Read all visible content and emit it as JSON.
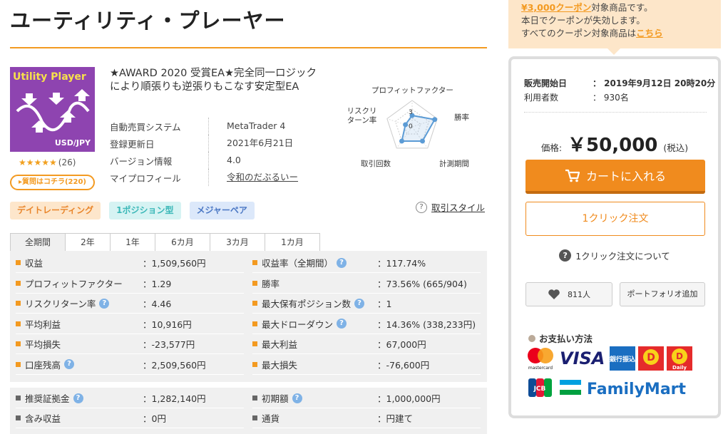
{
  "page": {
    "title": "ユーティリティ・プレーヤー"
  },
  "product": {
    "image_title": "Utility Player",
    "image_pair": "USD/JPY",
    "rating_stars": "★★★★★",
    "rating_count": "(26)",
    "qa_button": "▸質問はコチラ(220)",
    "headline": "★AWARD 2020 受賞EA★完全同一ロジックにより順張りも逆張りもこなす安定型EA",
    "meta": [
      {
        "label": "自動売買システム",
        "value": "MetaTrader 4"
      },
      {
        "label": "登録更新日",
        "value": "2021年6月21日"
      },
      {
        "label": "バージョン情報",
        "value": "4.0"
      },
      {
        "label": "マイプロフィール",
        "value": "令和のだぶるいー"
      }
    ],
    "tags": [
      "デイトレーディング",
      "1ポジション型",
      "メジャーペア"
    ],
    "trade_style_link": "取引スタイル"
  },
  "radar": {
    "labels": {
      "profit_factor": "プロフィットファクター",
      "win_rate": "勝率",
      "period": "計測期間",
      "trades": "取引回数",
      "risk_return": "リスクリターン率"
    },
    "scale_max": "3",
    "scale_min": "0",
    "values": {
      "profit_factor": 1.3,
      "win_rate": 2.7,
      "period": 2.0,
      "trades": 2.0,
      "risk_return": 0.8
    }
  },
  "tabs": [
    "全期間",
    "2年",
    "1年",
    "6カ月",
    "3カ月",
    "1カ月"
  ],
  "stats_left": [
    {
      "label": "収益",
      "value": "：1,509,560円",
      "help": false
    },
    {
      "label": "プロフィットファクター",
      "value": "：1.29",
      "help": false
    },
    {
      "label": "リスクリターン率",
      "value": "：4.46",
      "help": true
    },
    {
      "label": "平均利益",
      "value": "：10,916円",
      "help": false
    },
    {
      "label": "平均損失",
      "value": "：-23,577円",
      "help": false
    },
    {
      "label": "口座残高",
      "value": "：2,509,560円",
      "help": true
    }
  ],
  "stats_right": [
    {
      "label": "収益率（全期間）",
      "value": "：117.74%",
      "help": true
    },
    {
      "label": "勝率",
      "value": "：73.56% (665/904)",
      "help": false
    },
    {
      "label": "最大保有ポジション数",
      "value": "：1",
      "help": true
    },
    {
      "label": "最大ドローダウン",
      "value": "：14.36% (338,233円)",
      "help": true
    },
    {
      "label": "最大利益",
      "value": "：67,000円",
      "help": false
    },
    {
      "label": "最大損失",
      "value": "：-76,600円",
      "help": false
    }
  ],
  "stats2_left": [
    {
      "label": "推奨証拠金",
      "value": "：1,282,140円",
      "help": true
    },
    {
      "label": "含み収益",
      "value": "：0円",
      "help": false
    }
  ],
  "stats2_right": [
    {
      "label": "初期額",
      "value": "：1,000,000円",
      "help": true
    },
    {
      "label": "通貨",
      "value": "：円建て",
      "help": false
    }
  ],
  "coupon": {
    "line1_link": "¥3,000クーポン",
    "line1_rest": "対象商品です。",
    "line2": "本日でクーポンが失効します。",
    "line3": "すべてのクーポン対象商品は",
    "line3_link": "こちら"
  },
  "sidebar": {
    "sale_start_label": "販売開始日",
    "sale_start_value": "：  2019年9月12日 20時20分",
    "users_label": "利用者数",
    "users_value": "：  930名",
    "price_label": "価格:",
    "price_value": "￥50,000",
    "price_tax": "(税込)",
    "cart_button": "カートに入れる",
    "oneclick_button": "1クリック注文",
    "oneclick_about": "1クリック注文について",
    "fav_count": "811人",
    "portfolio_button": "ポートフォリオ追加",
    "payment_title": "お支払い方法",
    "payment_visa": "VISA",
    "payment_bank": "銀行振込",
    "payment_daily": "Daily",
    "payment_familymart": "FamilyMart",
    "payment_jcb": "JCB",
    "payment_mastercard": "mastercard"
  }
}
